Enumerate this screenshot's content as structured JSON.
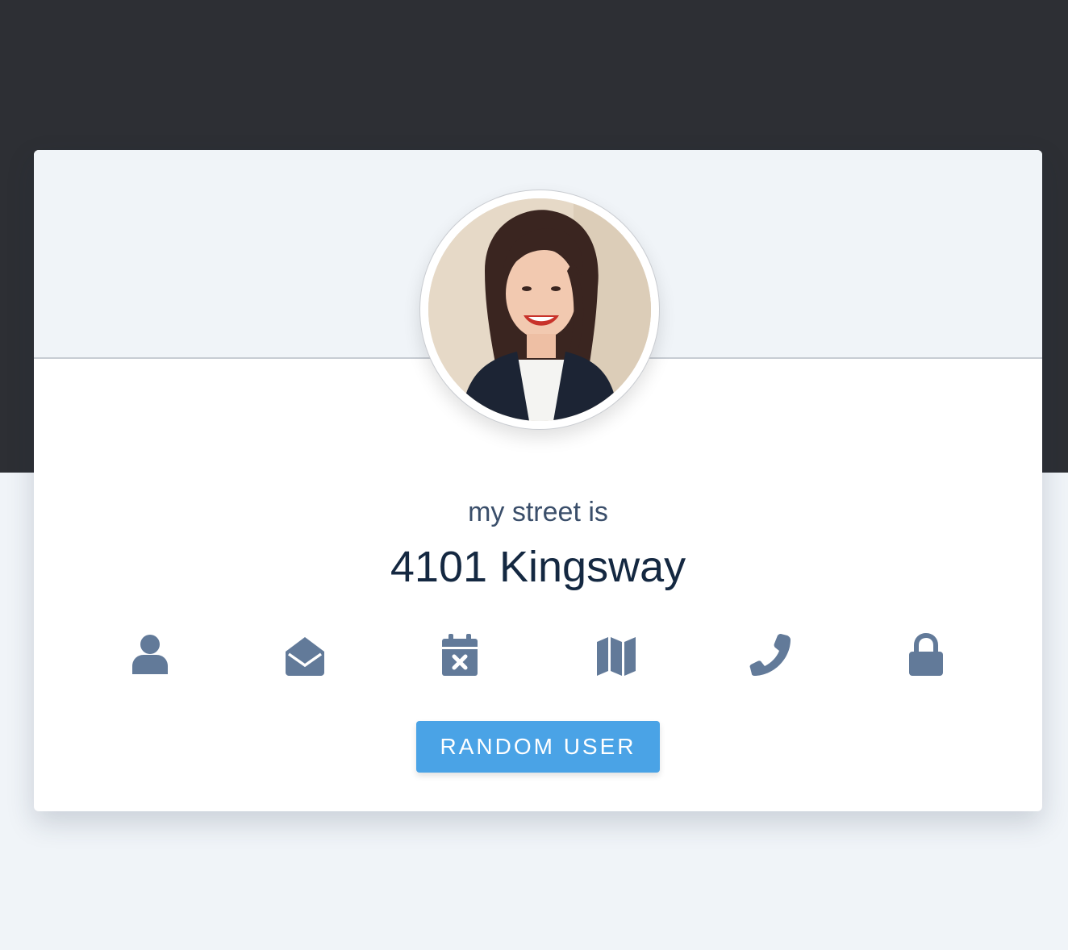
{
  "profile": {
    "label": "my street is",
    "value": "4101 Kingsway"
  },
  "icons": [
    {
      "name": "user-icon"
    },
    {
      "name": "envelope-open-icon"
    },
    {
      "name": "calendar-x-icon"
    },
    {
      "name": "map-icon"
    },
    {
      "name": "phone-icon"
    },
    {
      "name": "lock-icon"
    }
  ],
  "actions": {
    "random_user_label": "RANDOM USER"
  },
  "colors": {
    "top_band": "#2d2f34",
    "background": "#f0f4f8",
    "icon": "#627a99",
    "button": "#4aa3e6",
    "value_text": "#142841"
  }
}
